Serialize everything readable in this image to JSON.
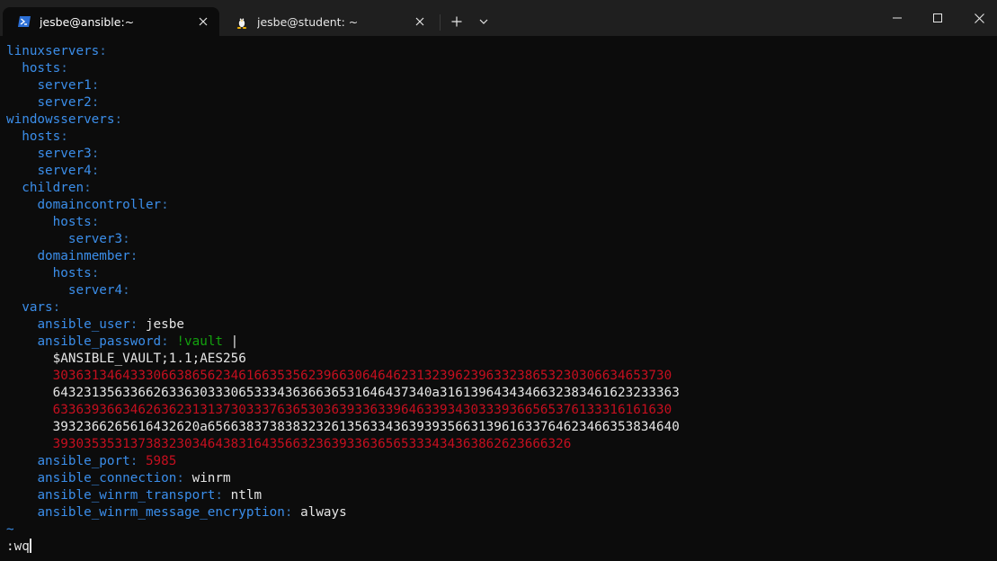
{
  "tabs": [
    {
      "title": "jesbe@ansible:~",
      "icon": "powershell-icon",
      "active": true
    },
    {
      "title": "jesbe@student: ~",
      "icon": "linux-penguin-icon",
      "active": false
    }
  ],
  "tabbar": {
    "new_tab_symbol": "+",
    "dropdown_icon": "chevron-down-icon"
  },
  "colors": {
    "background": "#0c0c0c",
    "titlebar": "#1f1f1f",
    "key": "#3b8eea",
    "string_green": "#13a10e",
    "vault_red": "#c50f1f",
    "text": "#e5e5e5"
  },
  "editor": {
    "lines": [
      [
        {
          "t": "linuxservers",
          "c": "k"
        },
        {
          "t": ":",
          "c": "c"
        }
      ],
      [
        {
          "t": "  "
        },
        {
          "t": "hosts",
          "c": "k"
        },
        {
          "t": ":",
          "c": "c"
        }
      ],
      [
        {
          "t": "    "
        },
        {
          "t": "server1",
          "c": "k"
        },
        {
          "t": ":",
          "c": "c"
        }
      ],
      [
        {
          "t": "    "
        },
        {
          "t": "server2",
          "c": "k"
        },
        {
          "t": ":",
          "c": "c"
        }
      ],
      [
        {
          "t": "windowsservers",
          "c": "k"
        },
        {
          "t": ":",
          "c": "c"
        }
      ],
      [
        {
          "t": "  "
        },
        {
          "t": "hosts",
          "c": "k"
        },
        {
          "t": ":",
          "c": "c"
        }
      ],
      [
        {
          "t": "    "
        },
        {
          "t": "server3",
          "c": "k"
        },
        {
          "t": ":",
          "c": "c"
        }
      ],
      [
        {
          "t": "    "
        },
        {
          "t": "server4",
          "c": "k"
        },
        {
          "t": ":",
          "c": "c"
        }
      ],
      [
        {
          "t": "  "
        },
        {
          "t": "children",
          "c": "k"
        },
        {
          "t": ":",
          "c": "c"
        }
      ],
      [
        {
          "t": "    "
        },
        {
          "t": "domaincontroller",
          "c": "k"
        },
        {
          "t": ":",
          "c": "c"
        }
      ],
      [
        {
          "t": "      "
        },
        {
          "t": "hosts",
          "c": "k"
        },
        {
          "t": ":",
          "c": "c"
        }
      ],
      [
        {
          "t": "        "
        },
        {
          "t": "server3",
          "c": "k"
        },
        {
          "t": ":",
          "c": "c"
        }
      ],
      [
        {
          "t": "    "
        },
        {
          "t": "domainmember",
          "c": "k"
        },
        {
          "t": ":",
          "c": "c"
        }
      ],
      [
        {
          "t": "      "
        },
        {
          "t": "hosts",
          "c": "k"
        },
        {
          "t": ":",
          "c": "c"
        }
      ],
      [
        {
          "t": "        "
        },
        {
          "t": "server4",
          "c": "k"
        },
        {
          "t": ":",
          "c": "c"
        }
      ],
      [
        {
          "t": "  "
        },
        {
          "t": "vars",
          "c": "k"
        },
        {
          "t": ":",
          "c": "c"
        }
      ],
      [
        {
          "t": "    "
        },
        {
          "t": "ansible_user",
          "c": "k"
        },
        {
          "t": ": ",
          "c": "c"
        },
        {
          "t": "jesbe",
          "c": "v"
        }
      ],
      [
        {
          "t": "    "
        },
        {
          "t": "ansible_password",
          "c": "k"
        },
        {
          "t": ": ",
          "c": "c"
        },
        {
          "t": "!vault",
          "c": "g"
        },
        {
          "t": " |",
          "c": "w"
        }
      ],
      [
        {
          "t": "      "
        },
        {
          "t": "$ANSIBLE_VAULT;1.1;AES256",
          "c": "w"
        }
      ],
      [
        {
          "t": "      "
        },
        {
          "t": "30363134643330663865623461663535623966306464623132396239633238653230306634653730",
          "c": "r"
        }
      ],
      [
        {
          "t": "      "
        },
        {
          "t": "6432313563366263363033306533343636636531646437340a3161396434346632383461623233363",
          "c": "w"
        }
      ],
      [
        {
          "t": "      "
        },
        {
          "t": "63363936634626362313137303337636530363933633964633934303339366565376133316161630",
          "c": "r"
        }
      ],
      [
        {
          "t": "      "
        },
        {
          "t": "3932366265616432620a6566383738383232613563343639393566313961633764623466353834640",
          "c": "w"
        }
      ],
      [
        {
          "t": "      "
        },
        {
          "t": "3930353531373832303464383164356632363933636565333434363862623666326",
          "c": "r"
        }
      ],
      [
        {
          "t": "    "
        },
        {
          "t": "ansible_port",
          "c": "k"
        },
        {
          "t": ": ",
          "c": "c"
        },
        {
          "t": "5985",
          "c": "r"
        }
      ],
      [
        {
          "t": "    "
        },
        {
          "t": "ansible_connection",
          "c": "k"
        },
        {
          "t": ": ",
          "c": "c"
        },
        {
          "t": "winrm",
          "c": "v"
        }
      ],
      [
        {
          "t": "    "
        },
        {
          "t": "ansible_winrm_transport",
          "c": "k"
        },
        {
          "t": ": ",
          "c": "c"
        },
        {
          "t": "ntlm",
          "c": "v"
        }
      ],
      [
        {
          "t": "    "
        },
        {
          "t": "ansible_winrm_message_encryption",
          "c": "k"
        },
        {
          "t": ": ",
          "c": "c"
        },
        {
          "t": "always",
          "c": "v"
        }
      ],
      [
        {
          "t": "~",
          "c": "k"
        }
      ]
    ],
    "command_line": ":wq"
  }
}
